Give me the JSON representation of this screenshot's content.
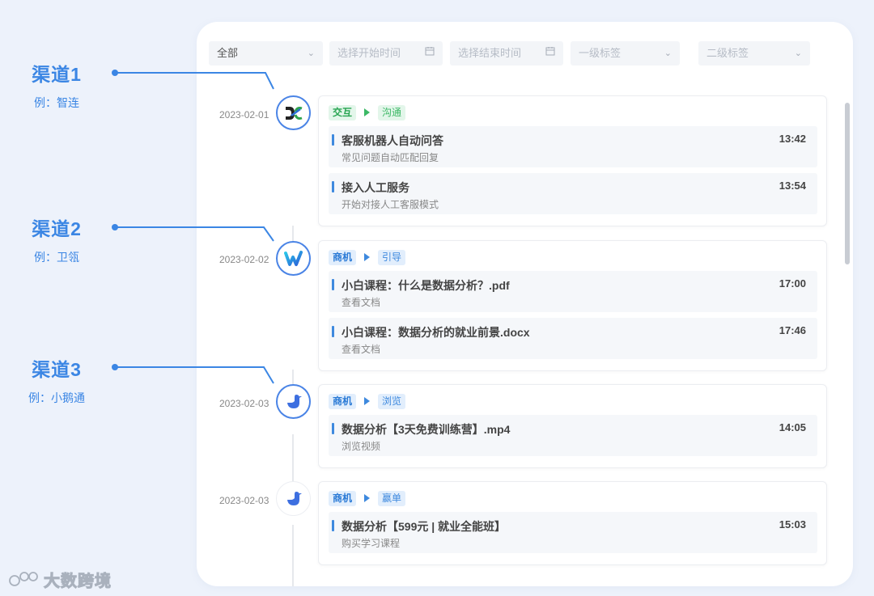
{
  "annotations": [
    {
      "title": "渠道1",
      "example": "例：智连"
    },
    {
      "title": "渠道2",
      "example": "例：卫瓴"
    },
    {
      "title": "渠道3",
      "example": "例：小鹅通"
    }
  ],
  "filters": {
    "channel": "全部",
    "start_time_placeholder": "选择开始时间",
    "end_time_placeholder": "选择结束时间",
    "level1_tag_placeholder": "一级标签",
    "level2_tag_placeholder": "二级标签"
  },
  "timeline": [
    {
      "date": "2023-02-01",
      "icon": "zhilian-logo-icon",
      "tag_primary": "交互",
      "tag_secondary": "沟通",
      "tag_color": "#27a451",
      "items": [
        {
          "title": "客服机器人自动问答",
          "subtitle": "常见问题自动匹配回复",
          "time": "13:42"
        },
        {
          "title": "接入人工服务",
          "subtitle": "开始对接人工客服模式",
          "time": "13:54"
        }
      ]
    },
    {
      "date": "2023-02-02",
      "icon": "weiling-logo-icon",
      "tag_primary": "商机",
      "tag_secondary": "引导",
      "tag_color": "#2a7ad6",
      "items": [
        {
          "title": "小白课程：什么是数据分析？.pdf",
          "subtitle": "查看文档",
          "time": "17:00"
        },
        {
          "title": "小白课程：数据分析的就业前景.docx",
          "subtitle": "查看文档",
          "time": "17:46"
        }
      ]
    },
    {
      "date": "2023-02-03",
      "icon": "xiaoetong-goose-icon",
      "tag_primary": "商机",
      "tag_secondary": "浏览",
      "tag_color": "#2a7ad6",
      "items": [
        {
          "title": "数据分析【3天免费训练营】.mp4",
          "subtitle": "浏览视频",
          "time": "14:05"
        }
      ]
    },
    {
      "date": "2023-02-03",
      "icon": "xiaoetong-goose-icon",
      "tag_primary": "商机",
      "tag_secondary": "赢单",
      "tag_color": "#2a7ad6",
      "items": [
        {
          "title": "数据分析【599元 | 就业全能班】",
          "subtitle": "购买学习课程",
          "time": "15:03"
        }
      ]
    }
  ],
  "watermark": {
    "text": "大数跨境"
  },
  "colors": {
    "accent": "#3b86e4",
    "green": "#27a451",
    "background": "#edf2fb"
  }
}
